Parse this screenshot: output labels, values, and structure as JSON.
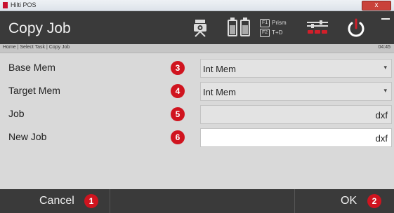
{
  "window": {
    "app_name": "Hilti POS",
    "close_glyph": "x"
  },
  "header": {
    "title": "Copy Job",
    "fkeys": [
      {
        "key": "F1",
        "label": "Prism"
      },
      {
        "key": "F2",
        "label": "T+D"
      }
    ],
    "battery_labels": [
      "BAT",
      "BAT"
    ]
  },
  "breadcrumb": {
    "path": "Home | Select Task | Copy Job",
    "time": "04:45"
  },
  "form": {
    "rows": [
      {
        "label": "Base Mem",
        "badge": "3",
        "value": "Int Mem",
        "type": "dropdown"
      },
      {
        "label": "Target Mem",
        "badge": "4",
        "value": "Int Mem",
        "type": "dropdown"
      },
      {
        "label": "Job",
        "badge": "5",
        "value": "dxf",
        "type": "readonly"
      },
      {
        "label": "New Job",
        "badge": "6",
        "value": "dxf",
        "type": "input"
      }
    ]
  },
  "footer": {
    "cancel_label": "Cancel",
    "cancel_badge": "1",
    "ok_label": "OK",
    "ok_badge": "2"
  },
  "colors": {
    "header_bg": "#3a3a3a",
    "badge_red": "#d0141f",
    "content_bg": "#d9d9d9"
  },
  "icons": [
    "tripod-icon",
    "battery-icon",
    "fkey-icon",
    "settings-icon",
    "power-icon"
  ]
}
